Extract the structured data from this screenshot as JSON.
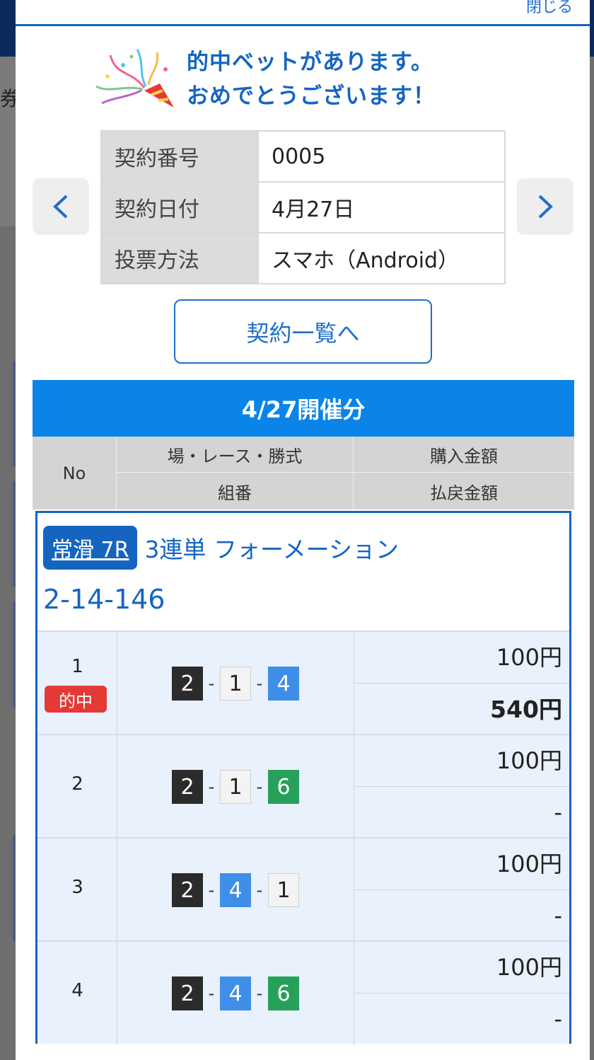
{
  "background": {
    "side_char": "券"
  },
  "modal": {
    "close_label": "閉じる",
    "congrats": {
      "line1": "的中ベットがあります。",
      "line2": "おめでとうございます！"
    },
    "contract": [
      {
        "key": "契約番号",
        "value": "0005"
      },
      {
        "key": "契約日付",
        "value": "4月27日"
      },
      {
        "key": "投票方法",
        "value": "スマホ（Android）"
      }
    ],
    "list_button": "契約一覧へ",
    "date_header": "4/27開催分",
    "columns": {
      "no": "No",
      "race": "場・レース・勝式",
      "kumi": "組番",
      "buy": "購入金額",
      "pay": "払戻金額"
    },
    "ticket": {
      "venue": "常滑 7R",
      "bet_type": "3連単 フォーメーション",
      "combination": "2-14-146",
      "rows": [
        {
          "no": "1",
          "hit": "的中",
          "nums": [
            "2",
            "1",
            "4"
          ],
          "colors": [
            "black",
            "white",
            "blue"
          ],
          "buy": "100円",
          "pay": "540円"
        },
        {
          "no": "2",
          "hit": "",
          "nums": [
            "2",
            "1",
            "6"
          ],
          "colors": [
            "black",
            "white",
            "green"
          ],
          "buy": "100円",
          "pay": "-"
        },
        {
          "no": "3",
          "hit": "",
          "nums": [
            "2",
            "4",
            "1"
          ],
          "colors": [
            "black",
            "blue",
            "white"
          ],
          "buy": "100円",
          "pay": "-"
        },
        {
          "no": "4",
          "hit": "",
          "nums": [
            "2",
            "4",
            "6"
          ],
          "colors": [
            "black",
            "blue",
            "green"
          ],
          "buy": "100円",
          "pay": "-"
        }
      ]
    }
  }
}
